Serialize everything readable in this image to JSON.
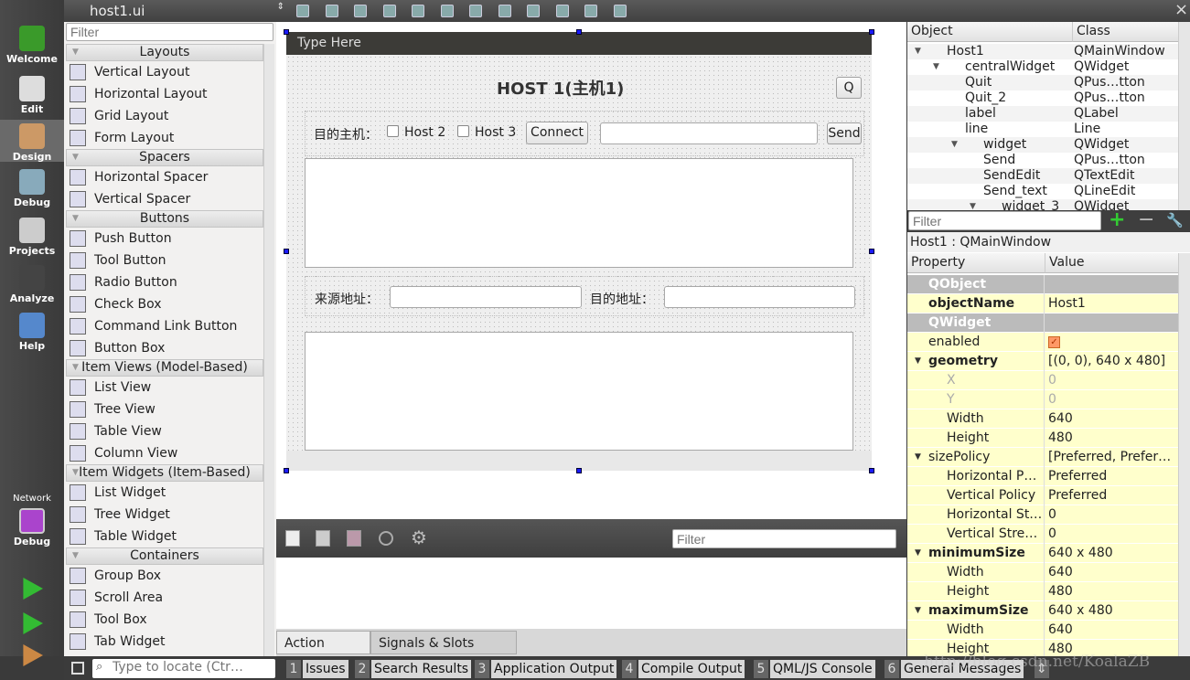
{
  "modebar": {
    "items": [
      "Welcome",
      "Edit",
      "Design",
      "Debug",
      "Projects",
      "Analyze",
      "Help"
    ],
    "selected": "Design",
    "kit_label": "Network",
    "kit_mode": "Debug"
  },
  "topbar": {
    "file": "host1.ui",
    "close": "×"
  },
  "widgetbox": {
    "filter_placeholder": "Filter",
    "sections": [
      {
        "title": "Layouts",
        "items": [
          "Vertical Layout",
          "Horizontal Layout",
          "Grid Layout",
          "Form Layout"
        ]
      },
      {
        "title": "Spacers",
        "items": [
          "Horizontal Spacer",
          "Vertical Spacer"
        ]
      },
      {
        "title": "Buttons",
        "items": [
          "Push Button",
          "Tool Button",
          "Radio Button",
          "Check Box",
          "Command Link Button",
          "Button Box"
        ]
      },
      {
        "title": "Item Views (Model-Based)",
        "items": [
          "List View",
          "Tree View",
          "Table View",
          "Column View"
        ]
      },
      {
        "title": "Item Widgets (Item-Based)",
        "items": [
          "List Widget",
          "Tree Widget",
          "Table Widget"
        ]
      },
      {
        "title": "Containers",
        "items": [
          "Group Box",
          "Scroll Area",
          "Tool Box",
          "Tab Widget"
        ]
      }
    ]
  },
  "form": {
    "menu_placeholder": "Type Here",
    "title": "HOST 1(主机1)",
    "quit_label": "Q",
    "dest_label": "目的主机：",
    "host2": "Host 2",
    "host3": "Host 3",
    "connect": "Connect",
    "send": "Send",
    "src_addr": "来源地址：",
    "dst_addr": "目的地址："
  },
  "action_editor": {
    "filter_placeholder": "Filter",
    "tabs": [
      "Action Editor",
      "Signals & Slots Editor"
    ],
    "active_tab": "Action Editor"
  },
  "object_inspector": {
    "headers": [
      "Object",
      "Class"
    ],
    "rows": [
      {
        "name": "Host1",
        "cls": "QMainWindow",
        "depth": 0,
        "expand": true
      },
      {
        "name": "centralWidget",
        "cls": "QWidget",
        "depth": 1,
        "expand": true
      },
      {
        "name": "Quit",
        "cls": "QPus…tton",
        "depth": 2
      },
      {
        "name": "Quit_2",
        "cls": "QPus…tton",
        "depth": 2
      },
      {
        "name": "label",
        "cls": "QLabel",
        "depth": 2
      },
      {
        "name": "line",
        "cls": "Line",
        "depth": 2
      },
      {
        "name": "widget",
        "cls": "QWidget",
        "depth": 2,
        "expand": true
      },
      {
        "name": "Send",
        "cls": "QPus…tton",
        "depth": 3
      },
      {
        "name": "SendEdit",
        "cls": "QTextEdit",
        "depth": 3
      },
      {
        "name": "Send_text",
        "cls": "QLineEdit",
        "depth": 3
      },
      {
        "name": "widget_3",
        "cls": "QWidget",
        "depth": 3,
        "expand": true
      }
    ]
  },
  "property_editor": {
    "filter_placeholder": "Filter",
    "context": "Host1 : QMainWindow",
    "headers": [
      "Property",
      "Value"
    ],
    "rows": [
      {
        "name": "QObject",
        "type": "s"
      },
      {
        "name": "objectName",
        "value": "Host1",
        "type": "b"
      },
      {
        "name": "QWidget",
        "type": "s"
      },
      {
        "name": "enabled",
        "value": "",
        "checked": true,
        "type": "n"
      },
      {
        "name": "geometry",
        "value": "[(0, 0), 640 x 480]",
        "type": "b"
      },
      {
        "name": "X",
        "value": "0",
        "type": "cg"
      },
      {
        "name": "Y",
        "value": "0",
        "type": "cg"
      },
      {
        "name": "Width",
        "value": "640",
        "type": "c"
      },
      {
        "name": "Height",
        "value": "480",
        "type": "c"
      },
      {
        "name": "sizePolicy",
        "value": "[Preferred, Prefer…",
        "type": "n"
      },
      {
        "name": "Horizontal P…",
        "value": "Preferred",
        "type": "c"
      },
      {
        "name": "Vertical Policy",
        "value": "Preferred",
        "type": "c"
      },
      {
        "name": "Horizontal St…",
        "value": "0",
        "type": "c"
      },
      {
        "name": "Vertical Stre…",
        "value": "0",
        "type": "c"
      },
      {
        "name": "minimumSize",
        "value": "640 x 480",
        "type": "b"
      },
      {
        "name": "Width",
        "value": "640",
        "type": "c"
      },
      {
        "name": "Height",
        "value": "480",
        "type": "c"
      },
      {
        "name": "maximumSize",
        "value": "640 x 480",
        "type": "b"
      },
      {
        "name": "Width",
        "value": "640",
        "type": "c"
      },
      {
        "name": "Height",
        "value": "480",
        "type": "c"
      }
    ]
  },
  "statusbar": {
    "locate_placeholder": "Type to locate (Ctr…",
    "panes": [
      {
        "n": "1",
        "label": "Issues"
      },
      {
        "n": "2",
        "label": "Search Results"
      },
      {
        "n": "3",
        "label": "Application Output"
      },
      {
        "n": "4",
        "label": "Compile Output"
      },
      {
        "n": "5",
        "label": "QML/JS Console"
      },
      {
        "n": "6",
        "label": "General Messages"
      }
    ]
  },
  "watermark": "http://blog.csdn.net/KoalaZB"
}
